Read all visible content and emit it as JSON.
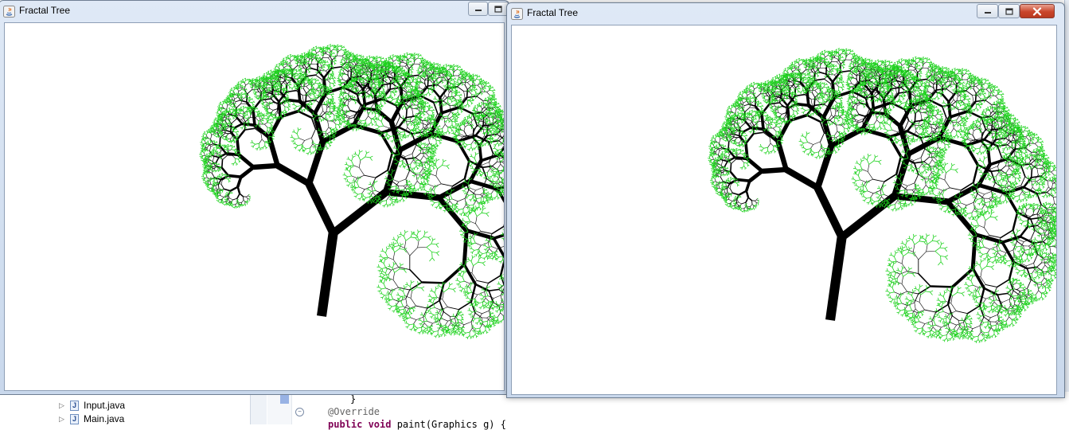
{
  "windows": [
    {
      "title": "Fractal Tree"
    },
    {
      "title": "Fractal Tree"
    }
  ],
  "ide": {
    "files": [
      {
        "icon": "J",
        "label": "Input.java"
      },
      {
        "icon": "J",
        "label": "Main.java"
      }
    ],
    "code": {
      "line1": "}",
      "line2": "@Override",
      "line3_keyword": "public void",
      "line3_rest": " paint(Graphics g) {"
    }
  },
  "colors": {
    "branch": "#000000",
    "leaf": "#1ed21e",
    "title_bar": "#dfe9f6",
    "close_button": "#c9452b"
  }
}
